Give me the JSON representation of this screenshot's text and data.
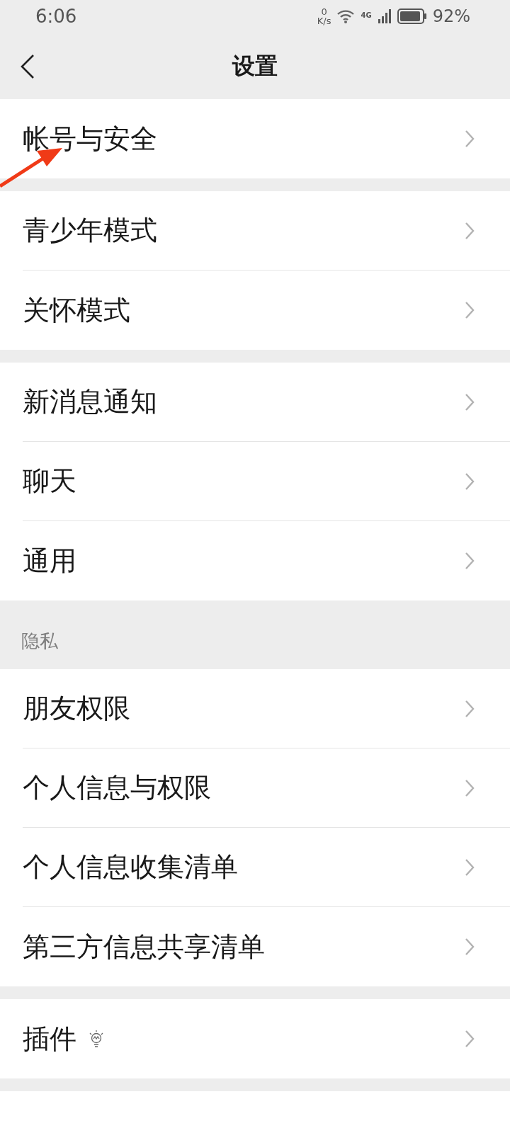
{
  "status_bar": {
    "time": "6:06",
    "speed_value": "0",
    "speed_unit": "K/s",
    "network": "4G",
    "battery": "92%"
  },
  "header": {
    "title": "设置"
  },
  "groups": [
    {
      "items": [
        {
          "label": "帐号与安全",
          "kind": "plain"
        }
      ]
    },
    {
      "items": [
        {
          "label": "青少年模式",
          "kind": "plain"
        },
        {
          "label": "关怀模式",
          "kind": "plain"
        }
      ]
    },
    {
      "items": [
        {
          "label": "新消息通知",
          "kind": "plain"
        },
        {
          "label": "聊天",
          "kind": "plain"
        },
        {
          "label": "通用",
          "kind": "plain"
        }
      ]
    },
    {
      "header": "隐私",
      "items": [
        {
          "label": "朋友权限",
          "kind": "plain"
        },
        {
          "label": "个人信息与权限",
          "kind": "plain"
        },
        {
          "label": "个人信息收集清单",
          "kind": "plain"
        },
        {
          "label": "第三方信息共享清单",
          "kind": "plain"
        }
      ]
    },
    {
      "items": [
        {
          "label": "插件",
          "kind": "bulb"
        }
      ]
    }
  ]
}
